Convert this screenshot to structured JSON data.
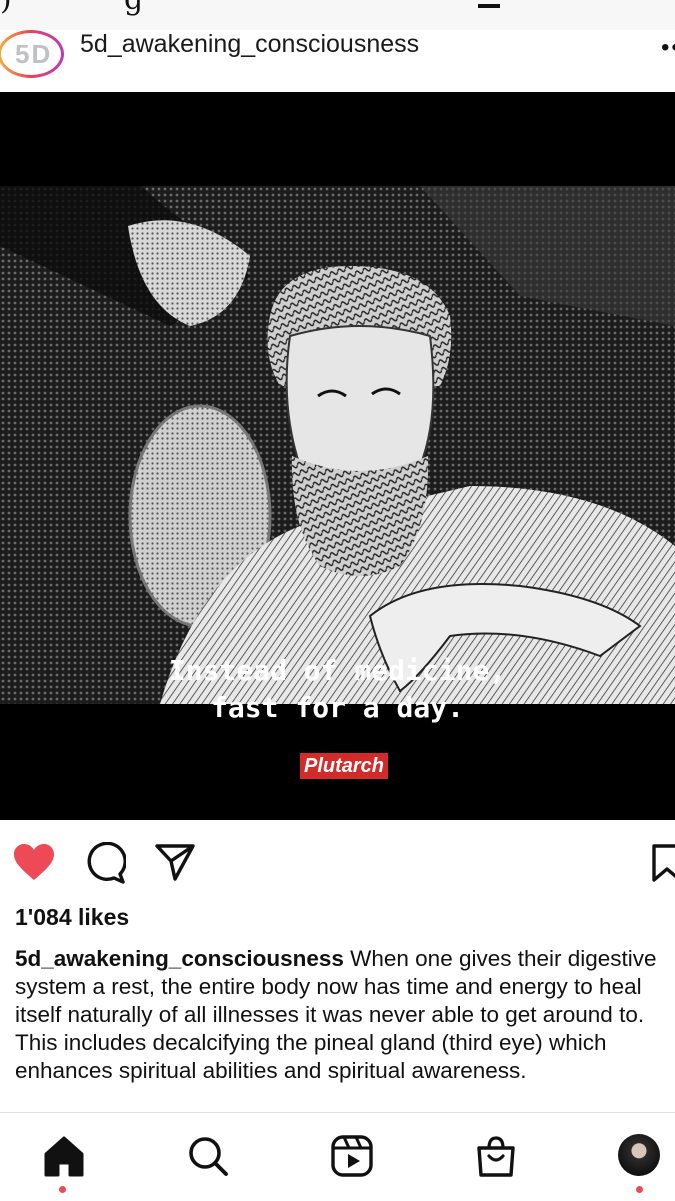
{
  "post": {
    "username": "5d_awakening_consciousness",
    "avatar_text": "5D",
    "quote_line1": "Instead of medicine,",
    "quote_line2": "fast for a day.",
    "quote_author": "Plutarch",
    "likes": "1'084 likes",
    "caption_user": "5d_awakening_consciousness",
    "caption_text": " When one gives their digestive system a rest, the entire body now has time and energy to heal itself naturally of all illnesses it was never able to get around to. This includes decalcifying the pineal gland (third eye) which enhances spiritual abilities and spiritual awareness."
  },
  "actions": {
    "icons": [
      "heart-icon",
      "comment-icon",
      "share-icon",
      "bookmark-icon"
    ],
    "liked_color": "#ed4956"
  },
  "nav": {
    "items": [
      "home-icon",
      "search-icon",
      "reels-icon",
      "shop-icon",
      "profile-avatar"
    ],
    "dot_color": "#ed4956"
  }
}
